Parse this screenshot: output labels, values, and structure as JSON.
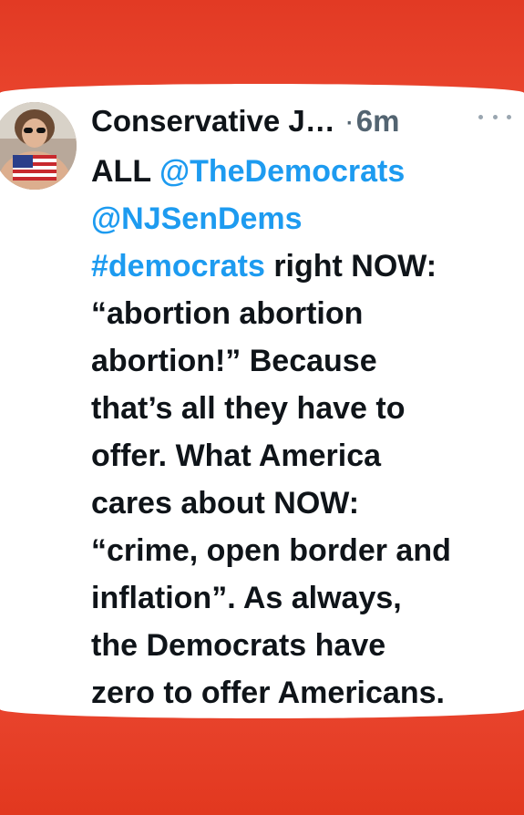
{
  "post": {
    "author_name": "Conservative J…",
    "separator": "·",
    "time": "6m",
    "lines": [
      {
        "prefix": "ALL ",
        "link": "@TheDemocrats",
        "suffix": ""
      },
      {
        "prefix": "",
        "link": "@NJSenDems",
        "suffix": ""
      },
      {
        "prefix": "",
        "link": "#democrats",
        "suffix": " right NOW:"
      },
      {
        "prefix": "“abortion abortion",
        "link": "",
        "suffix": ""
      },
      {
        "prefix": "abortion!” Because",
        "link": "",
        "suffix": ""
      },
      {
        "prefix": "that’s all they have to",
        "link": "",
        "suffix": ""
      },
      {
        "prefix": "offer. What America",
        "link": "",
        "suffix": ""
      },
      {
        "prefix": "cares about NOW:",
        "link": "",
        "suffix": ""
      },
      {
        "prefix": "“crime, open border and",
        "link": "",
        "suffix": ""
      },
      {
        "prefix": "inflation”. As always,",
        "link": "",
        "suffix": ""
      },
      {
        "prefix": "the Democrats have",
        "link": "",
        "suffix": ""
      },
      {
        "prefix": "zero to offer Americans.",
        "link": "",
        "suffix": ""
      }
    ]
  },
  "icons": {
    "avatar": "avatar-photo",
    "more": "more-options-icon"
  },
  "colors": {
    "link": "#1d9bf0",
    "text": "#0f1419",
    "muted": "#536471",
    "background_band": "#e63b26"
  }
}
